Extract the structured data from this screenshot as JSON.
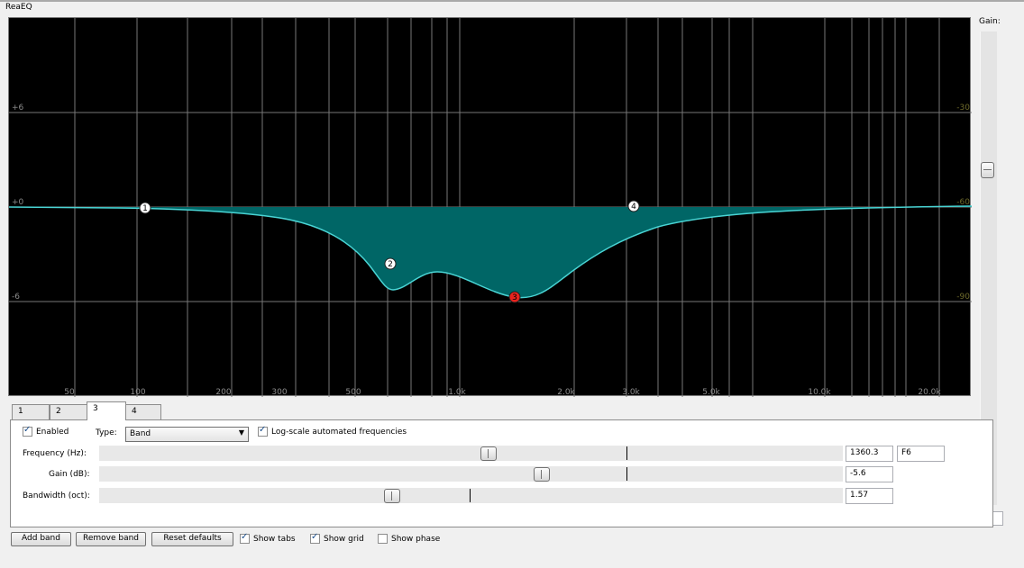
{
  "window": {
    "title": "ReaEQ"
  },
  "graph": {
    "left_db_labels": [
      "+6",
      "+0",
      "-6"
    ],
    "right_db_labels": [
      "-30",
      "-60",
      "-90"
    ],
    "freq_labels": [
      "50",
      "100",
      "200",
      "300",
      "500",
      "1.0k",
      "2.0k",
      "3.0k",
      "5.0k",
      "10.0k",
      "20.0k"
    ],
    "nodes": [
      {
        "label": "1",
        "selected": false
      },
      {
        "label": "2",
        "selected": false
      },
      {
        "label": "3",
        "selected": true
      },
      {
        "label": "4",
        "selected": false
      }
    ],
    "colors": {
      "curve": "#49d4d4",
      "fill": "#006666",
      "grid": "#777777",
      "node_selected": "#e8231e"
    }
  },
  "gain": {
    "label": "Gain:",
    "value": "0.0"
  },
  "tabs": [
    {
      "label": "1"
    },
    {
      "label": "2"
    },
    {
      "label": "3"
    },
    {
      "label": "4"
    }
  ],
  "active_tab": "3",
  "band": {
    "enabled_label": "Enabled",
    "enabled": true,
    "type_label": "Type:",
    "type_value": "Band",
    "log_scale_label": "Log-scale automated frequencies",
    "log_scale": true,
    "frequency": {
      "label": "Frequency (Hz):",
      "value": "1360.3",
      "note": "F6"
    },
    "gain": {
      "label": "Gain (dB):",
      "value": "-5.6"
    },
    "bandwidth": {
      "label": "Bandwidth (oct):",
      "value": "1.57"
    }
  },
  "bottom": {
    "add_band": "Add band",
    "remove_band": "Remove band",
    "reset_defaults": "Reset defaults",
    "show_tabs": "Show tabs",
    "show_grid": "Show grid",
    "show_phase": "Show phase"
  }
}
